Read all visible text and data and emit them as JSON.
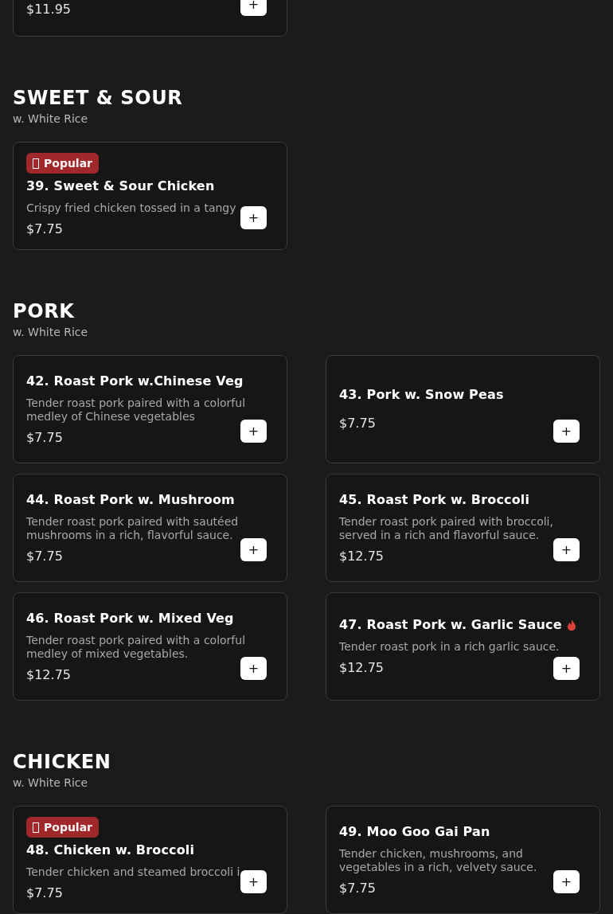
{
  "top_card": {
    "price": "$11.95",
    "add_button": "+"
  },
  "sections": [
    {
      "title": "SWEET & SOUR",
      "subtitle": "w. White Rice",
      "items": [
        {
          "badge": "Popular",
          "name": "39. Sweet & Sour Chicken",
          "spicy": false,
          "description": "Crispy fried chicken tossed in a tangy",
          "price": "$7.75",
          "add_button": "+"
        }
      ]
    },
    {
      "title": "PORK",
      "subtitle": "w. White Rice",
      "items": [
        {
          "name": "42. Roast Pork w.Chinese Veg",
          "spicy": false,
          "description": "Tender roast pork paired with a colorful medley of Chinese vegetables",
          "price": "$7.75",
          "add_button": "+"
        },
        {
          "name": "43. Pork w. Snow Peas",
          "spicy": false,
          "price": "$7.75",
          "add_button": "+"
        },
        {
          "name": "44. Roast Pork w. Mushroom",
          "spicy": false,
          "description": "Tender roast pork paired with sautéed mushrooms in a rich, flavorful sauce.",
          "price": "$7.75",
          "add_button": "+"
        },
        {
          "name": "45. Roast Pork w. Broccoli",
          "spicy": false,
          "description": "Tender roast pork paired with broccoli, served in a rich and flavorful sauce.",
          "price": "$12.75",
          "add_button": "+"
        },
        {
          "name": "46. Roast Pork w. Mixed Veg",
          "spicy": false,
          "description": "Tender roast pork paired with a colorful medley of mixed vegetables.",
          "price": "$12.75",
          "add_button": "+"
        },
        {
          "name": "47. Roast Pork w. Garlic Sauce",
          "spicy": true,
          "description": "Tender roast pork in a rich garlic sauce.",
          "price": "$12.75",
          "add_button": "+"
        }
      ]
    },
    {
      "title": "CHICKEN",
      "subtitle": "w. White Rice",
      "items": [
        {
          "badge": "Popular",
          "name": "48. Chicken w. Broccoli",
          "spicy": false,
          "description": "Tender chicken and steamed broccoli i",
          "price": "$7.75",
          "add_button": "+"
        },
        {
          "name": "49. Moo Goo Gai Pan",
          "spicy": false,
          "description": "Tender chicken, mushrooms, and vegetables in a rich, velvety sauce.",
          "price": "$7.75",
          "add_button": "+"
        }
      ]
    }
  ]
}
